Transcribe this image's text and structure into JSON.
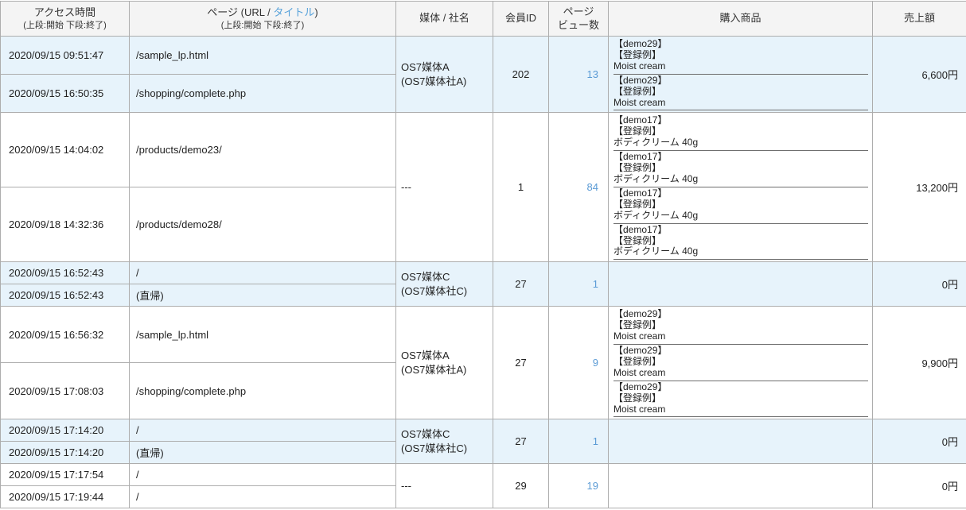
{
  "table": {
    "headers": {
      "access_time": {
        "title": "アクセス時間",
        "sub": "(上段:開始 下段:終了)"
      },
      "page": {
        "title_pre": "ページ (URL / ",
        "title_link": "タイトル",
        "title_post": ")",
        "sub": "(上段:開始 下段:終了)"
      },
      "media": "媒体 / 社名",
      "member_id": "会員ID",
      "pageviews_line1": "ページ",
      "pageviews_line2": "ビュー数",
      "products": "購入商品",
      "sales": "売上額"
    },
    "colors": {
      "row_highlight": "#e7f3fb",
      "link_blue": "#5b9bd5",
      "header_bg": "#f4f4f4",
      "border_gray": "#adadad"
    },
    "groups": [
      {
        "highlight": true,
        "rows": [
          {
            "time": "2020/09/15 09:51:47",
            "page": "/sample_lp.html"
          },
          {
            "time": "2020/09/15 16:50:35",
            "page": "/shopping/complete.php"
          }
        ],
        "media_lines": [
          "OS7媒体A",
          "(OS7媒体社A)"
        ],
        "member_id": "202",
        "pageviews": "13",
        "products": [
          {
            "lines": [
              "【demo29】",
              "【登録例】",
              "Moist cream"
            ]
          },
          {
            "lines": [
              "【demo29】",
              "【登録例】",
              "Moist cream"
            ]
          }
        ],
        "sales": "6,600円"
      },
      {
        "highlight": false,
        "rows": [
          {
            "time": "2020/09/15 14:04:02",
            "page": "/products/demo23/"
          },
          {
            "time": "2020/09/18 14:32:36",
            "page": "/products/demo28/"
          }
        ],
        "media_lines": [
          "---"
        ],
        "member_id": "1",
        "pageviews": "84",
        "products": [
          {
            "lines": [
              "【demo17】",
              "【登録例】",
              "ボディクリーム 40g"
            ]
          },
          {
            "lines": [
              "【demo17】",
              "【登録例】",
              "ボディクリーム 40g"
            ]
          },
          {
            "lines": [
              "【demo17】",
              "【登録例】",
              "ボディクリーム 40g"
            ]
          },
          {
            "lines": [
              "【demo17】",
              "【登録例】",
              "ボディクリーム 40g"
            ]
          }
        ],
        "sales": "13,200円"
      },
      {
        "highlight": true,
        "rows": [
          {
            "time": "2020/09/15 16:52:43",
            "page": "/"
          },
          {
            "time": "2020/09/15 16:52:43",
            "page": "(直帰)"
          }
        ],
        "media_lines": [
          "OS7媒体C",
          "(OS7媒体社C)"
        ],
        "member_id": "27",
        "pageviews": "1",
        "products": [],
        "sales": "0円"
      },
      {
        "highlight": false,
        "rows": [
          {
            "time": "2020/09/15 16:56:32",
            "page": "/sample_lp.html"
          },
          {
            "time": "2020/09/15 17:08:03",
            "page": "/shopping/complete.php"
          }
        ],
        "media_lines": [
          "OS7媒体A",
          "(OS7媒体社A)"
        ],
        "member_id": "27",
        "pageviews": "9",
        "products": [
          {
            "lines": [
              "【demo29】",
              "【登録例】",
              "Moist cream"
            ]
          },
          {
            "lines": [
              "【demo29】",
              "【登録例】",
              "Moist cream"
            ]
          },
          {
            "lines": [
              "【demo29】",
              "【登録例】",
              "Moist cream"
            ]
          }
        ],
        "sales": "9,900円"
      },
      {
        "highlight": true,
        "rows": [
          {
            "time": "2020/09/15 17:14:20",
            "page": "/"
          },
          {
            "time": "2020/09/15 17:14:20",
            "page": "(直帰)"
          }
        ],
        "media_lines": [
          "OS7媒体C",
          "(OS7媒体社C)"
        ],
        "member_id": "27",
        "pageviews": "1",
        "products": [],
        "sales": "0円"
      },
      {
        "highlight": false,
        "rows": [
          {
            "time": "2020/09/15 17:17:54",
            "page": "/"
          },
          {
            "time": "2020/09/15 17:19:44",
            "page": "/"
          }
        ],
        "media_lines": [
          "---"
        ],
        "member_id": "29",
        "pageviews": "19",
        "products": [],
        "sales": "0円"
      }
    ]
  }
}
